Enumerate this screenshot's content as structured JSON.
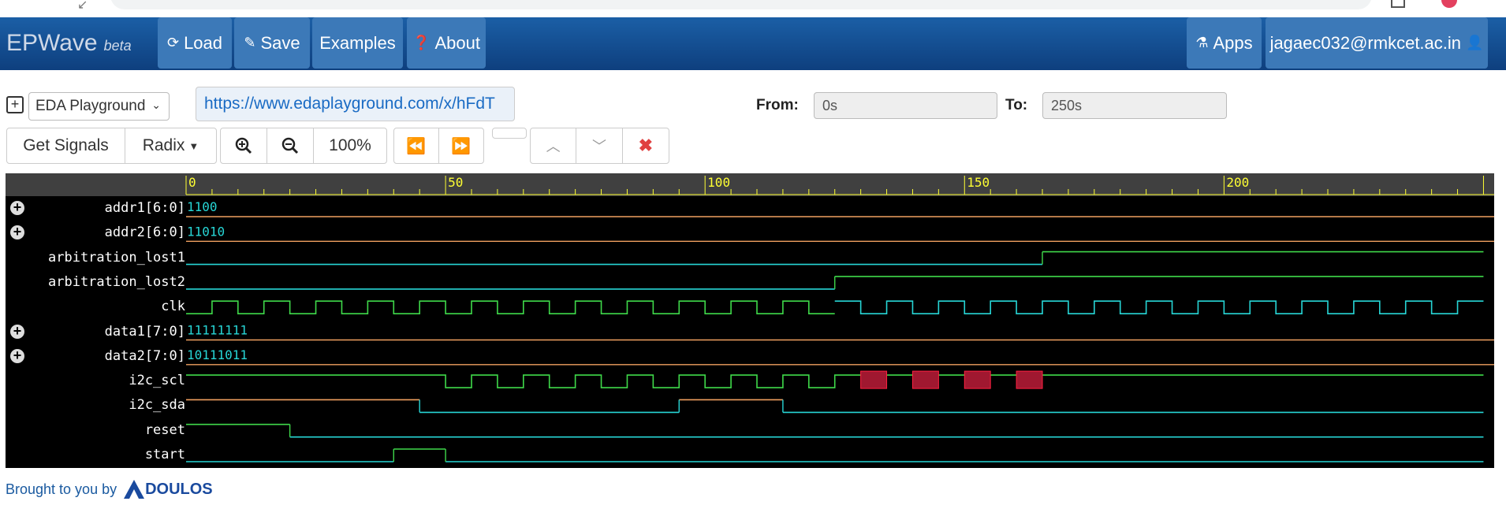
{
  "navbar": {
    "brand": "EPWave",
    "brand_tag": "beta",
    "load_label": "Load",
    "save_label": "Save",
    "examples_label": "Examples",
    "about_label": "About",
    "apps_label": "Apps",
    "user_label": "jagaec032@rmkcet.ac.in"
  },
  "controls": {
    "library_select": "EDA Playground",
    "share_url": "https://www.edaplayground.com/x/hFdT",
    "from_label": "From:",
    "from_value": "0s",
    "to_label": "To:",
    "to_value": "250s",
    "get_signals_label": "Get Signals",
    "radix_label": "Radix",
    "zoom_level": "100%"
  },
  "icons": {
    "load": "refresh-icon",
    "save": "pencil-icon",
    "about": "question-circle-icon",
    "apps": "flask-icon",
    "user": "user-icon",
    "expand": "plus-square-icon",
    "zoom_in": "zoom-in-icon",
    "zoom_out": "zoom-out-icon",
    "prev_edge": "fast-backward-icon",
    "next_edge": "fast-forward-icon",
    "move_up": "chevron-up-icon",
    "move_down": "chevron-down-icon",
    "remove": "close-icon"
  },
  "colors": {
    "navbar": "#1b5fa6",
    "wave_green": "#3fd94a",
    "wave_cyan": "#27d6d6",
    "wave_orange": "#f0a060",
    "unknown_red": "#a01830",
    "ruler_yellow": "#ffff33"
  },
  "waveform": {
    "time_range": [
      0,
      250
    ],
    "ruler_labels": [
      "0",
      "50",
      "100",
      "150",
      "200"
    ],
    "signals": [
      {
        "name": "addr1[6:0]",
        "bus": true,
        "value": "1100"
      },
      {
        "name": "addr2[6:0]",
        "bus": true,
        "value": "11010"
      },
      {
        "name": "arbitration_lost1",
        "bus": false
      },
      {
        "name": "arbitration_lost2",
        "bus": false
      },
      {
        "name": "clk",
        "bus": false
      },
      {
        "name": "data1[7:0]",
        "bus": true,
        "value": "11111111"
      },
      {
        "name": "data2[7:0]",
        "bus": true,
        "value": "10111011"
      },
      {
        "name": "i2c_scl",
        "bus": false
      },
      {
        "name": "i2c_sda",
        "bus": false
      },
      {
        "name": "reset",
        "bus": false
      },
      {
        "name": "start",
        "bus": false
      }
    ],
    "transitions": {
      "arbitration_lost1": {
        "init": 0,
        "edges": [
          165
        ]
      },
      "arbitration_lost2": {
        "init": 0,
        "edges": [
          125
        ]
      },
      "clk": {
        "init": 0,
        "period": 5,
        "start": 0
      },
      "i2c_scl": {
        "init": 1,
        "low_pulses": [
          [
            50,
            55
          ],
          [
            60,
            65
          ],
          [
            70,
            75
          ],
          [
            80,
            85
          ],
          [
            90,
            95
          ],
          [
            100,
            105
          ],
          [
            110,
            115
          ],
          [
            120,
            125
          ]
        ],
        "x_pulses": [
          [
            130,
            135
          ],
          [
            140,
            145
          ],
          [
            150,
            155
          ],
          [
            160,
            165
          ]
        ]
      },
      "i2c_sda": {
        "init": 1,
        "edges": [
          45,
          95,
          115
        ]
      },
      "reset": {
        "init": 1,
        "edges": [
          20
        ]
      },
      "start": {
        "init": 0,
        "edges": [
          40,
          50
        ]
      }
    }
  },
  "footer": {
    "text": "Brought to you by",
    "logo": "DOULOS"
  }
}
